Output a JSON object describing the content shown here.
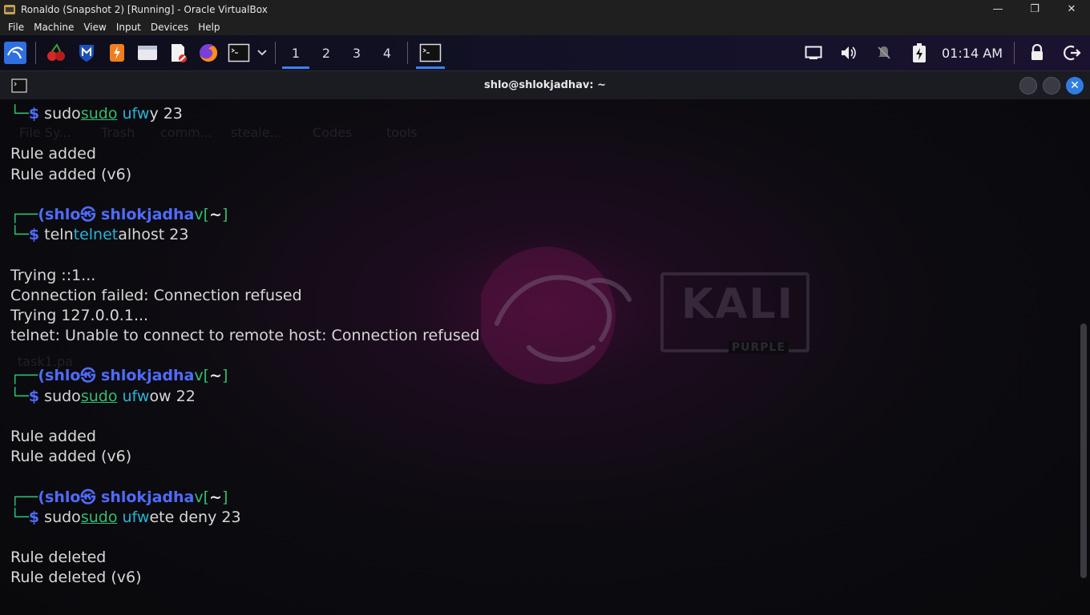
{
  "vbox": {
    "title": "Ronaldo (Snapshot 2) [Running] - Oracle VirtualBox",
    "menu": [
      "File",
      "Machine",
      "View",
      "Input",
      "Devices",
      "Help"
    ]
  },
  "panel": {
    "workspaces": [
      "1",
      "2",
      "3",
      "4"
    ],
    "clock": "01:14 AM"
  },
  "terminal": {
    "title": "shlo@shlokjadhav: ~",
    "lines": {
      "l1_a": "sudo",
      "l1_b": "sudo",
      "l1_c": " ufw",
      "l1_d": "y 23",
      "l2": "Rule added",
      "l3": "Rule added (v6)",
      "p2_user": "(shlo㉿ shlokjadha",
      "p2_v": "v",
      "p2_dir": "~",
      "l4_a": "teln",
      "l4_b": "telnet",
      "l4_c": "alhost 23",
      "l5": "Trying ::1...",
      "l6": "Connection failed: Connection refused",
      "l7": "Trying 127.0.0.1...",
      "l8": "telnet: Unable to connect to remote host: Connection refused",
      "p3_user": "(shlo㉿ shlokjadha",
      "p3_v": "v",
      "p3_dir": "~",
      "l9_a": "sudo",
      "l9_b": "sudo",
      "l9_c": " ufw",
      "l9_d": "ow 22",
      "l10": "Rule added",
      "l11": "Rule added (v6)",
      "p4_user": "(shlo㉿ shlokjadha",
      "p4_v": "v",
      "p4_dir": "~",
      "l12_a": "sudo",
      "l12_b": "sudo",
      "l12_c": " ufw",
      "l12_d": "ete deny 23",
      "l13": "Rule deleted",
      "l14": "Rule deleted (v6)"
    }
  },
  "wallpaper": {
    "badge_big": "KALI",
    "badge_small": "PURPLE",
    "desktop_icons": [
      "File Sy...",
      "Trash",
      "comm...",
      "steale...",
      "Codes",
      "tools",
      "task1.pa"
    ]
  }
}
